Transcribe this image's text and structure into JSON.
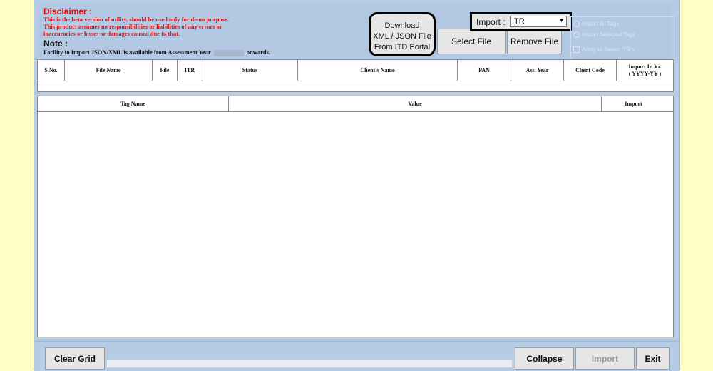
{
  "disclaimer": {
    "title": "Disclaimer :",
    "lines": [
      "This is the beta version of utility, should be used only for demo purpose.",
      "This product assumes no responsibilities or liabilities of any errors or",
      "inaccuracies or losses or damages caused due to that."
    ]
  },
  "note": {
    "title": "Note :",
    "text_before": "Facility to Import JSON/XML is available from Assessment Year",
    "text_after": "onwards."
  },
  "toolbar": {
    "download_lines": [
      "Download",
      "XML / JSON File",
      "From ITD Portal"
    ],
    "select_file": "Select File",
    "remove_file": "Remove File",
    "import_label": "Import :",
    "import_value": "ITR"
  },
  "options": {
    "import_all": "Import All Tags",
    "import_selected": "Import Selected Tags",
    "apply_to_all": "Apply to Select ITR's"
  },
  "files_grid": {
    "columns": [
      "S.No.",
      "File Name",
      "File",
      "ITR",
      "Status",
      "Client's Name",
      "PAN",
      "Ass. Year",
      "Client Code",
      "Import In Yr.\n( YYYY-YY )"
    ]
  },
  "tags_grid": {
    "columns": [
      "Tag Name",
      "Value",
      "Import"
    ]
  },
  "footer": {
    "clear_grid": "Clear Grid",
    "collapse": "Collapse",
    "import": "Import",
    "exit": "Exit"
  }
}
